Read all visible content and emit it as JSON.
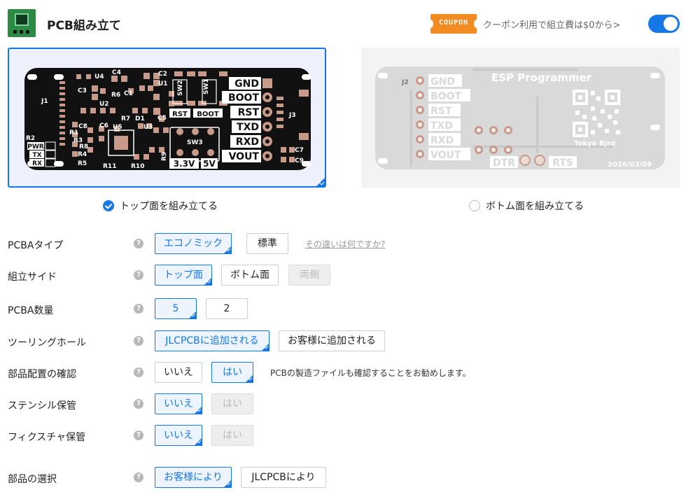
{
  "header": {
    "title": "PCB組み立て",
    "coupon_badge": "COUPON",
    "coupon_text": "クーポン利用で組立費は$0から>",
    "toggle_on": true
  },
  "boards": {
    "top": {
      "pins": [
        "GND",
        "BOOT",
        "RST",
        "TXD",
        "RXD",
        "VOUT"
      ],
      "buttons": [
        "RST",
        "BOOT"
      ],
      "labels": [
        "3.3V",
        "5V",
        "PWR",
        "TX",
        "RX",
        "SW1",
        "SW2",
        "SW3",
        "J1",
        "J3",
        "U1",
        "U2",
        "U3",
        "U4",
        "U5",
        "C1",
        "C2",
        "C3",
        "C4",
        "C5",
        "C6",
        "C7",
        "C8",
        "C9",
        "D1",
        "R1",
        "R2",
        "R3",
        "R4",
        "R5",
        "R6",
        "R7",
        "R8",
        "R9",
        "R10",
        "R11"
      ]
    },
    "bottom": {
      "pins": [
        "GND",
        "BOOT",
        "RST",
        "TXD",
        "RXD",
        "VOUT"
      ],
      "title": "ESP Programmer",
      "brand": "Tokyo Bjrd",
      "date": "2026/03/09",
      "connector": "J2",
      "side_labels": [
        "DTR",
        "RTS"
      ]
    }
  },
  "side_select": {
    "top_label": "トップ面を組み立てる",
    "bottom_label": "ボトム面を組み立てる",
    "selected": "top"
  },
  "options": {
    "pcba_type": {
      "label": "PCBAタイプ",
      "choices": [
        "エコノミック",
        "標準"
      ],
      "selected": "エコノミック",
      "link": "その違いは何ですか?"
    },
    "assembly_side": {
      "label": "組立サイド",
      "choices": [
        "トップ面",
        "ボトム面",
        "両側"
      ],
      "selected": "トップ面",
      "disabled": [
        "両側"
      ]
    },
    "pcba_qty": {
      "label": "PCBA数量",
      "choices": [
        "5",
        "2"
      ],
      "selected": "5"
    },
    "tooling_holes": {
      "label": "ツーリングホール",
      "choices": [
        "JLCPCBに追加される",
        "お客様に追加される"
      ],
      "selected": "JLCPCBに追加される"
    },
    "placement_confirm": {
      "label": "部品配置の確認",
      "choices": [
        "いいえ",
        "はい"
      ],
      "selected": "はい",
      "note": "PCBの製造ファイルも確認することをお勧めします。"
    },
    "stencil": {
      "label": "ステンシル保管",
      "choices": [
        "いいえ",
        "はい"
      ],
      "selected": "いいえ",
      "disabled": [
        "はい"
      ]
    },
    "fixture": {
      "label": "フィクスチャ保管",
      "choices": [
        "いいえ",
        "はい"
      ],
      "selected": "いいえ",
      "disabled": [
        "はい"
      ]
    },
    "parts_select": {
      "label": "部品の選択",
      "choices": [
        "お客様により",
        "JLCPCBにより"
      ],
      "selected": "お客様により"
    }
  },
  "help_icon": "?",
  "colors": {
    "accent": "#1677e8",
    "coupon": "#f28b22",
    "pcb_black": "#111111",
    "pcb_gray": "#d8d8d8"
  }
}
